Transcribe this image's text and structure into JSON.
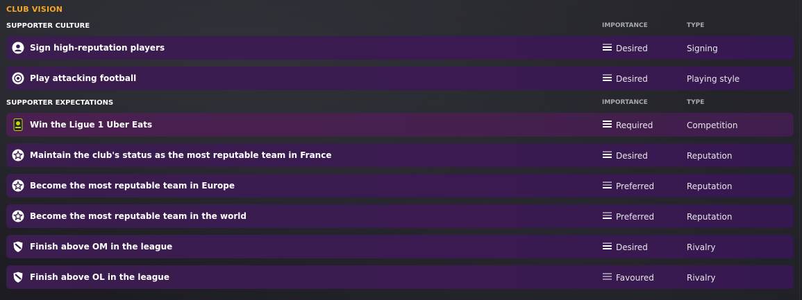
{
  "panel": {
    "title": "CLUB VISION"
  },
  "sections": [
    {
      "header": "SUPPORTER CULTURE",
      "importance_header": "IMPORTANCE",
      "type_header": "TYPE",
      "rows": [
        {
          "icon": "person-icon",
          "label": "Sign high-reputation players",
          "importance": "Desired",
          "type": "Signing"
        },
        {
          "icon": "football-icon",
          "label": "Play attacking football",
          "importance": "Desired",
          "type": "Playing style"
        }
      ]
    },
    {
      "header": "SUPPORTER EXPECTATIONS",
      "importance_header": "IMPORTANCE",
      "type_header": "TYPE",
      "rows": [
        {
          "icon": "league-logo-icon",
          "label": "Win the Ligue 1 Uber Eats",
          "importance": "Required",
          "type": "Competition"
        },
        {
          "icon": "star-icon",
          "label": "Maintain the club's status as the most reputable team in France",
          "importance": "Desired",
          "type": "Reputation"
        },
        {
          "icon": "star-icon",
          "label": "Become the most reputable team in Europe",
          "importance": "Preferred",
          "type": "Reputation"
        },
        {
          "icon": "star-icon",
          "label": "Become the most reputable team in the world",
          "importance": "Preferred",
          "type": "Reputation"
        },
        {
          "icon": "shield-icon",
          "label": "Finish above OM in the league",
          "importance": "Desired",
          "type": "Rivalry"
        },
        {
          "icon": "shield-icon",
          "label": "Finish above OL in the league",
          "importance": "Favoured",
          "type": "Rivalry"
        }
      ]
    }
  ],
  "colors": {
    "accent": "#f5a623",
    "row": "#3b1d4f"
  }
}
